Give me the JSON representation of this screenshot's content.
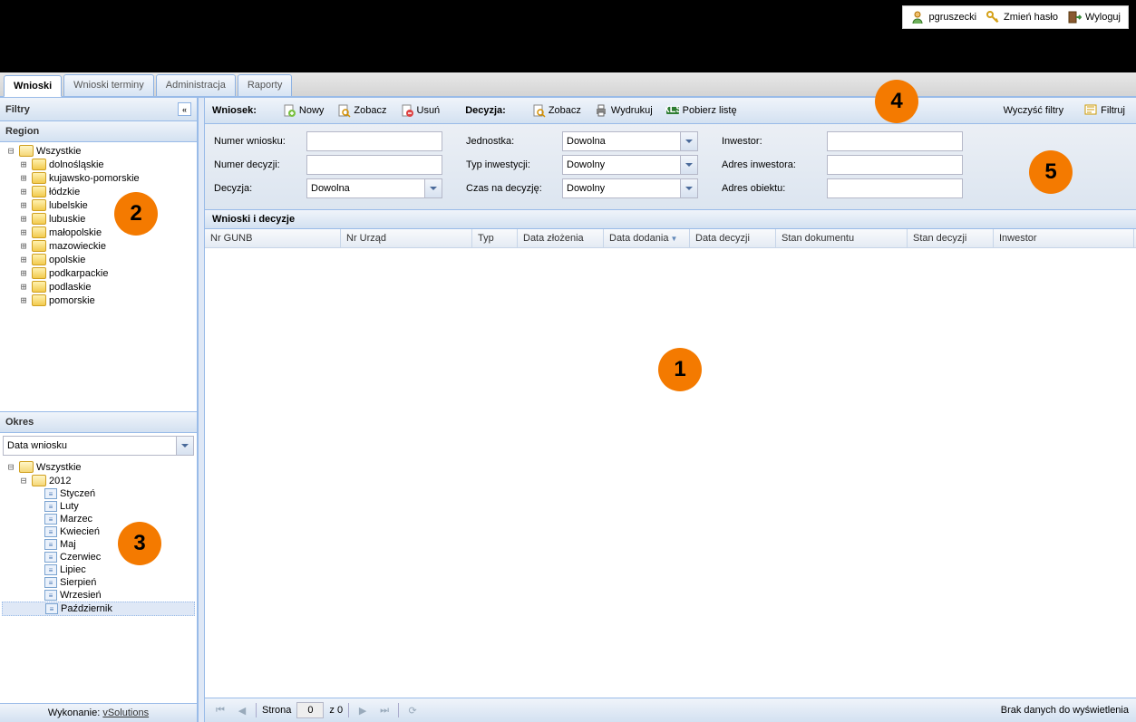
{
  "user": {
    "name": "pgruszecki",
    "changePw": "Zmień hasło",
    "logout": "Wyloguj"
  },
  "tabs": [
    {
      "label": "Wnioski",
      "active": true
    },
    {
      "label": "Wnioski terminy"
    },
    {
      "label": "Administracja"
    },
    {
      "label": "Raporty"
    }
  ],
  "sidebar": {
    "filters_title": "Filtry",
    "region": {
      "title": "Region",
      "root": "Wszystkie",
      "items": [
        "dolnośląskie",
        "kujawsko-pomorskie",
        "łódzkie",
        "lubelskie",
        "lubuskie",
        "małopolskie",
        "mazowieckie",
        "opolskie",
        "podkarpackie",
        "podlaskie",
        "pomorskie"
      ]
    },
    "okres": {
      "title": "Okres",
      "select": "Data wniosku",
      "root": "Wszystkie",
      "year": "2012",
      "months": [
        "Styczeń",
        "Luty",
        "Marzec",
        "Kwiecień",
        "Maj",
        "Czerwiec",
        "Lipiec",
        "Sierpień",
        "Wrzesień",
        "Październik"
      ]
    },
    "credits_label": "Wykonanie:",
    "credits_link": "vSolutions"
  },
  "toolbar": {
    "wniosek": "Wniosek:",
    "nowy": "Nowy",
    "zobacz": "Zobacz",
    "usun": "Usuń",
    "decyzja": "Decyzja:",
    "zobacz2": "Zobacz",
    "wydrukuj": "Wydrukuj",
    "pobierz": "Pobierz listę",
    "wyczysc": "Wyczyść filtry",
    "filtruj": "Filtruj"
  },
  "filters": {
    "numer_wniosku": "Numer wniosku:",
    "numer_decyzji": "Numer decyzji:",
    "decyzja": "Decyzja:",
    "decyzja_val": "Dowolna",
    "jednostka": "Jednostka:",
    "jednostka_val": "Dowolna",
    "typ": "Typ inwestycji:",
    "typ_val": "Dowolny",
    "czas": "Czas na decyzję:",
    "czas_val": "Dowolny",
    "inwestor": "Inwestor:",
    "adres_inw": "Adres inwestora:",
    "adres_ob": "Adres obiektu:"
  },
  "grid": {
    "title": "Wnioski i decyzje",
    "cols": [
      "Nr GUNB",
      "Nr Urząd",
      "Typ",
      "Data złożenia",
      "Data dodania",
      "Data decyzji",
      "Stan dokumentu",
      "Stan decyzji",
      "Inwestor"
    ],
    "sort_col": 4
  },
  "pager": {
    "page_label": "Strona",
    "page": "0",
    "of": "z 0",
    "status": "Brak danych do wyświetlenia"
  },
  "callouts": {
    "c1": "1",
    "c2": "2",
    "c3": "3",
    "c4": "4",
    "c5": "5"
  }
}
